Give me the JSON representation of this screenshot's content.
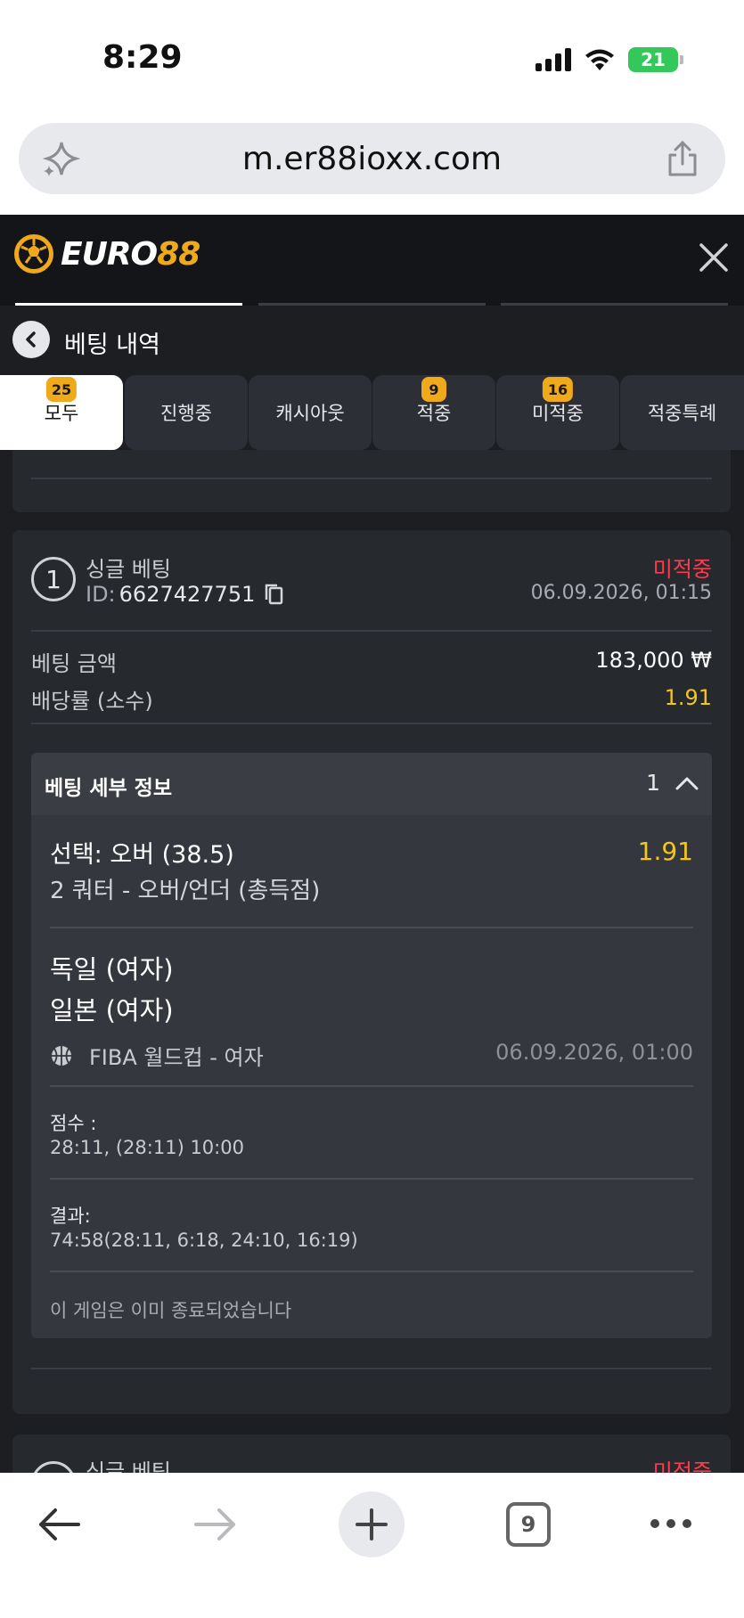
{
  "status_bar": {
    "time": "8:29",
    "battery": "21"
  },
  "browser": {
    "url": "m.er88ioxx.com",
    "tab_count": "9"
  },
  "site": {
    "logo_main": "EURO",
    "logo_accent": "88"
  },
  "page": {
    "title": "베팅 내역"
  },
  "filters": [
    {
      "label": "모두",
      "badge": "25"
    },
    {
      "label": "진행중",
      "badge": ""
    },
    {
      "label": "캐시아웃",
      "badge": ""
    },
    {
      "label": "적중",
      "badge": "9"
    },
    {
      "label": "미적중",
      "badge": "16"
    },
    {
      "label": "적중특례",
      "badge": ""
    }
  ],
  "bet": {
    "number": "1",
    "type": "싱글 베팅",
    "id_label": "ID:",
    "id_value": "6627427751",
    "status": "미적중",
    "date": "06.09.2026, 01:15",
    "amount_label": "베팅 금액",
    "amount_value": "183,000 ₩",
    "odds_label": "배당률 (소수)",
    "odds_value": "1.91",
    "details_title": "베팅 세부 정보",
    "details_count": "1",
    "selection": "선택: 오버 (38.5)",
    "selection_odds": "1.91",
    "market": "2 쿼터 - 오버/언더 (총득점)",
    "team_home": "독일 (여자)",
    "team_away": "일본 (여자)",
    "league": "FIBA 월드컵 - 여자",
    "match_date": "06.09.2026, 01:00",
    "score_label": "점수 :",
    "score_value": "28:11, (28:11) 10:00",
    "result_label": "결과:",
    "result_value": "74:58(28:11, 6:18, 24:10, 16:19)",
    "ended_note": "이 게임은 이미 종료되었습니다"
  },
  "next_bet": {
    "type": "싱글 베팅",
    "status": "미적중"
  }
}
